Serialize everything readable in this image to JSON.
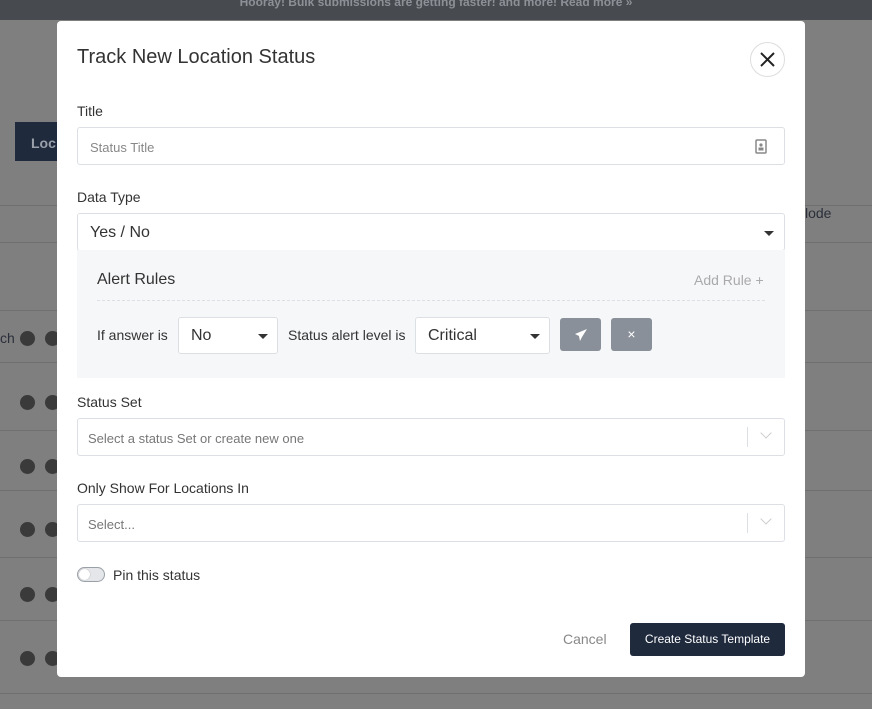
{
  "banner": {
    "text": "Hooray! Bulk submissions are getting faster! and more! Read more »"
  },
  "background": {
    "button_label": "Loc",
    "side_text": "lode",
    "row_text": "ch"
  },
  "modal": {
    "title": "Track New Location Status",
    "close_icon": "close-icon",
    "title_field": {
      "label": "Title",
      "placeholder": "Status Title",
      "icon": "contact-card-icon"
    },
    "data_type": {
      "label": "Data Type",
      "value": "Yes / No"
    },
    "alert_rules": {
      "heading": "Alert Rules",
      "add_rule": "Add Rule +",
      "rule": {
        "if_label": "If answer is",
        "answer": "No",
        "level_label": "Status alert level is",
        "level": "Critical",
        "send_icon": "paper-plane-icon",
        "remove_icon": "close-icon",
        "remove_label": "×"
      }
    },
    "status_set": {
      "label": "Status Set",
      "placeholder": "Select a status Set or create new one"
    },
    "locations": {
      "label": "Only Show For Locations In",
      "placeholder": "Select..."
    },
    "pin": {
      "label": "Pin this status",
      "on": false
    },
    "cancel": "Cancel",
    "submit": "Create Status Template"
  }
}
